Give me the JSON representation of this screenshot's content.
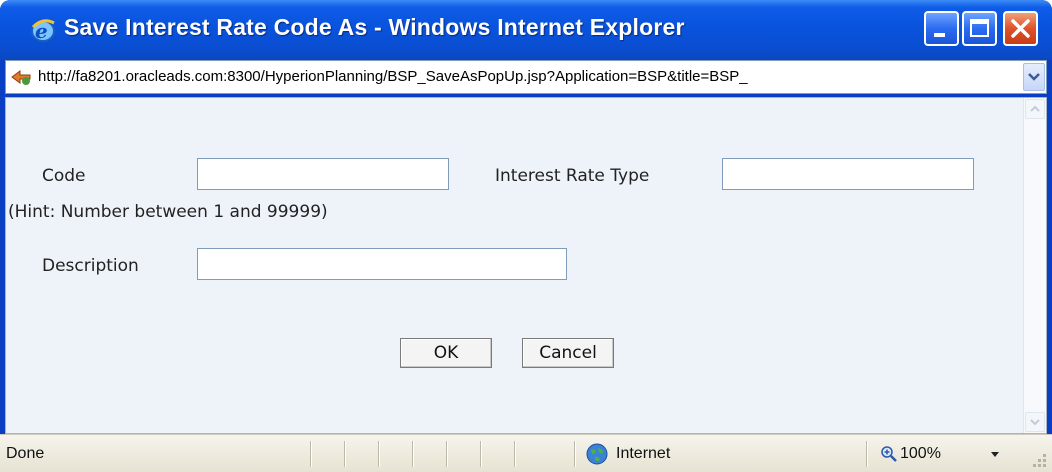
{
  "window": {
    "title": "Save Interest Rate Code As - Windows Internet Explorer",
    "icon": "ie-logo-icon"
  },
  "address": {
    "url": "http://fa8201.oracleads.com:8300/HyperionPlanning/BSP_SaveAsPopUp.jsp?Application=BSP&title=BSP_"
  },
  "form": {
    "code_label": "Code",
    "code_value": "",
    "hint": "(Hint: Number between 1 and 99999)",
    "interest_rate_type_label": "Interest Rate Type",
    "interest_rate_type_value": "",
    "description_label": "Description",
    "description_value": "",
    "ok_label": "OK",
    "cancel_label": "Cancel"
  },
  "status": {
    "text": "Done",
    "zone": "Internet",
    "zoom": "100%"
  },
  "colors": {
    "titlebar": "#0a4fd3",
    "content_bg": "#eef3fa",
    "close_button": "#e0522a"
  }
}
